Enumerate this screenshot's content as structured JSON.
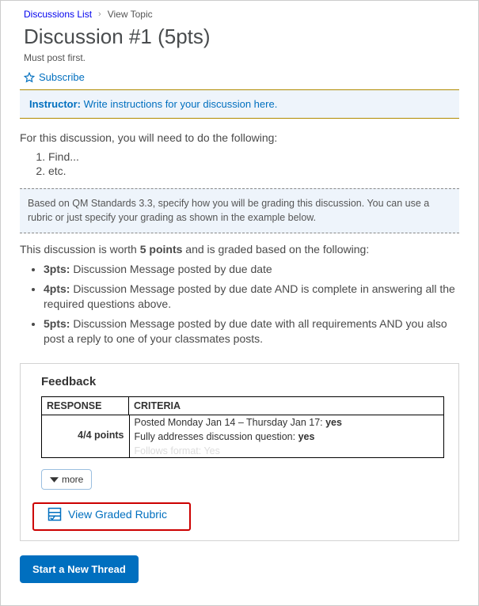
{
  "breadcrumb": {
    "root": "Discussions List",
    "current": "View Topic"
  },
  "title": "Discussion #1 (5pts)",
  "must_post": "Must post first.",
  "subscribe_label": "Subscribe",
  "instructor": {
    "label": "Instructor:",
    "text": "Write instructions for your discussion here."
  },
  "intro": "For this discussion, you will need to do the following:",
  "steps": [
    "Find...",
    "etc."
  ],
  "qm_note": "Based on QM Standards 3.3, specify how you will be grading this discussion. You can use a rubric or just specify your grading as shown in the example below.",
  "grading": {
    "prefix": "This discussion is worth ",
    "points_bold": "5 points",
    "suffix": " and is graded based on the following:",
    "levels": [
      {
        "pts": "3pts:",
        "text": "Discussion Message posted by due date"
      },
      {
        "pts": "4pts:",
        "text": "Discussion Message posted by due date AND is complete in answering all the required questions above."
      },
      {
        "pts": "5pts:",
        "text": "Discussion Message posted by due date with all requirements AND you also post a reply to one of your classmates posts."
      }
    ]
  },
  "feedback": {
    "heading": "Feedback",
    "col1": "RESPONSE",
    "col2": "CRITERIA",
    "score": "4/4 points",
    "crit1_text": "Posted Monday Jan 14 – Thursday Jan 17:  ",
    "crit1_val": "yes",
    "crit2_text": "Fully addresses discussion question:  ",
    "crit2_val": "yes",
    "crit3_text": "Follows format:  Yes",
    "more_label": "more"
  },
  "view_rubric": "View Graded Rubric",
  "start_btn": "Start a New Thread"
}
